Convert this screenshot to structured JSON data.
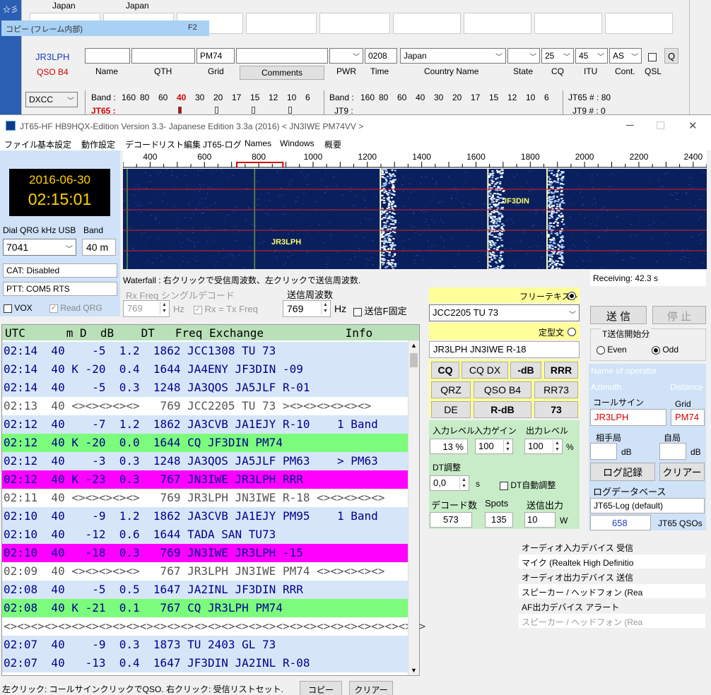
{
  "logger": {
    "top_labels": [
      "Japan",
      "Japan"
    ],
    "copy_bar": "コピー (フレーム内部)",
    "copy_bar_key": "F2",
    "callsign": "JR3LPH",
    "qso_label": "QSO B4",
    "name_label": "Name",
    "qth_label": "QTH",
    "grid_value": "PM74",
    "grid_label": "Grid",
    "comments_btn": "Comments",
    "pwr_label": "PWR",
    "time_value": "0208",
    "time_label": "Time",
    "country_value": "Japan",
    "country_label": "Country Name",
    "state_label": "State",
    "cq_value": "25",
    "cq_label": "CQ",
    "itu_value": "45",
    "itu_label": "ITU",
    "cont_value": "AS",
    "cont_label": "Cont.",
    "qsl_label": "QSL",
    "q_btn": "Q",
    "dxcc": "DXCC",
    "band_label1": "Band :",
    "bands": [
      "160",
      "80",
      "60",
      "40",
      "30",
      "20",
      "17",
      "15",
      "12",
      "10",
      "6"
    ],
    "band_label2": "Band :",
    "bands2": [
      "160",
      "80",
      "60",
      "40",
      "30",
      "20",
      "17",
      "15",
      "12",
      "10",
      "6"
    ],
    "jt65_row": "JT65 :",
    "jt9_row": "JT9 :",
    "jt65_count": "JT65 # : 80",
    "jt9_count": "JT9 # : 0"
  },
  "app": {
    "title": "JT65-HF HB9HQX-Edition Version 3.3- Japanese Edition 3.3a (2016)   < JN3IWE PM74VV >",
    "menu": [
      "ファイル",
      "基本設定",
      "動作設定",
      "デコード",
      "リスト編集",
      "JT65-ログ",
      "Names",
      "Windows",
      "概要"
    ],
    "date": "2016-06-30",
    "time": "02:15:01",
    "dial_label": "Dial QRG kHz USB",
    "band_label": "Band",
    "dial_value": "7041",
    "band_value": "40 m",
    "cat": "CAT: Disabled",
    "ptt": "PTT: COM5 RTS",
    "vox": "VOX",
    "read_qrg": "Read QRG",
    "scale_ticks": [
      "400",
      "600",
      "800",
      "1000",
      "1200",
      "1400",
      "1600",
      "1800",
      "2000",
      "2200",
      "2400"
    ],
    "wf_labels": [
      "JF3DIN",
      "JR3LPH"
    ],
    "waterfall_hint": "Waterfall : 右クリックで受信周波数、左クリックで送信周波数.",
    "receiving": "Receiving: 42.3 s",
    "rx_freq_label": "Rx Freq シングルデコード",
    "rx_freq_value": "769",
    "hz": "Hz",
    "rx_tx_label": "Rx = Tx Freq",
    "tx_freq_label": "送信周波数",
    "tx_freq_value": "769",
    "tx_fixed_label": "送信F固定",
    "table_header": "UTC      m D  dB    DT   Freq Exchange            Info",
    "rows": [
      {
        "text": "02:14  40    -5  1.2  1862 JCC1308 TU 73",
        "style": "blue"
      },
      {
        "text": "02:14  40 K -20  0.4  1644 JA4ENY JF3DIN -09",
        "style": "blue"
      },
      {
        "text": "02:14  40    -5  0.3  1248 JA3QOS JA5JLF R-01",
        "style": "blue"
      },
      {
        "text": "02:13  40 <><><><><>   769 JCC2205 TU 73 ><><><><><><>",
        "style": "white"
      },
      {
        "text": "02:12  40    -7  1.2  1862 JA3CVB JA1EJY R-10    1 Band",
        "style": "blue"
      },
      {
        "text": "02:12  40 K -20  0.0  1644 CQ JF3DIN PM74",
        "style": "green"
      },
      {
        "text": "02:12  40    -3  0.3  1248 JA3QOS JA5JLF PM63    > PM63",
        "style": "blue"
      },
      {
        "text": "02:12  40 K -23  0.3   767 JN3IWE JR3LPH RRR",
        "style": "magenta"
      },
      {
        "text": "02:11  40 <><><><><>   769 JR3LPH JN3IWE R-18 <><><><><>",
        "style": "white"
      },
      {
        "text": "02:10  40    -9  1.2  1862 JA3CVB JA1EJY PM95    1 Band",
        "style": "blue"
      },
      {
        "text": "02:10  40   -12  0.6  1644 TADA SAN TU73",
        "style": "blue"
      },
      {
        "text": "02:10  40   -18  0.3   769 JN3IWE JR3LPH -15",
        "style": "magenta"
      },
      {
        "text": "02:09  40 <><><><><>   767 JR3LPH JN3IWE PM74 <><><><><>",
        "style": "white"
      },
      {
        "text": "02:08  40    -5  0.5  1647 JA2INL JF3DIN RRR",
        "style": "blue"
      },
      {
        "text": "02:08  40 K -21  0.1   767 CQ JR3LPH PM74",
        "style": "green"
      },
      {
        "text": "<><><><><><><><><><><><><><><><><><><><><><><><><><><><><><><>",
        "style": "white"
      },
      {
        "text": "02:07  40    -9  0.3  1873 TU 2403 GL 73",
        "style": "blue"
      },
      {
        "text": "02:07  40   -13  0.4  1647 JF3DIN JA2INL R-08",
        "style": "blue"
      }
    ],
    "bottom_hint": "左クリック: コールサインクリックでQSO. 右クリック: 受信リストセット.",
    "copy_btn": "コピー",
    "clear_btn": "クリアー",
    "free_text_label": "フリーテキスト",
    "free_text_value": "JCC2205 TU 73",
    "fixed_text_label": "定型文",
    "fixed_text_value": "JR3LPH JN3IWE R-18",
    "macro_buttons": [
      "CQ",
      "CQ DX",
      "-dB",
      "RRR",
      "QRZ",
      "QSO B4",
      "RR73",
      "DE",
      "R-dB",
      "73"
    ],
    "input_level_label": "入力レベル",
    "input_gain_label": "入力ゲイン",
    "output_level_label": "出力レベル",
    "input_level_value": "13 %",
    "input_gain_value": "100",
    "output_level_value": "100",
    "pct": "%",
    "dt_label": "DT調整",
    "dt_value": "0,0",
    "s": "s",
    "dt_auto": "DT自動調整",
    "decode_count_label": "デコード数",
    "spots_label": "Spots",
    "tx_power_label": "送信出力",
    "decode_count_value": "573",
    "spots_value": "135",
    "tx_power_value": "10",
    "w": "W",
    "send_btn": "送 信",
    "stop_btn": "停 止",
    "tx_period_label": "T送信開始分",
    "even": "Even",
    "odd": "Odd",
    "operator_label": "Name of operator",
    "azimuth_label": "Azimuth",
    "distance_label": "Distance",
    "callsign_label": "コールサイン",
    "grid_label": "Grid",
    "callsign_value": "JR3LPH",
    "grid_value": "PM74",
    "their_label": "相手局",
    "own_label": "自局",
    "db": "dB",
    "log_btn": "ログ記録",
    "clear2_btn": "クリアー",
    "logdb_label": "ログデータベース",
    "logdb_value": "JT65-Log (default)",
    "qso_count": "658",
    "qso_label": "JT65 QSOs",
    "audio_in_label": "オーディオ入力デバイス  受信",
    "audio_in_value": "マイク (Realtek High Definitio",
    "audio_out_label": "オーディオ出力デバイス  送信",
    "audio_out_value": "スピーカー / ヘッドフォン (Rea",
    "af_out_label": "AF出力デバイス  アラート",
    "af_out_value": "スピーカー / ヘッドフォン (Rea"
  },
  "colors": {
    "row_blue": "#d6e6f8",
    "row_white": "#ffffff",
    "row_green": "#7cfc7c",
    "row_magenta": "#ff00ff",
    "highlight_red": "#d40000"
  }
}
